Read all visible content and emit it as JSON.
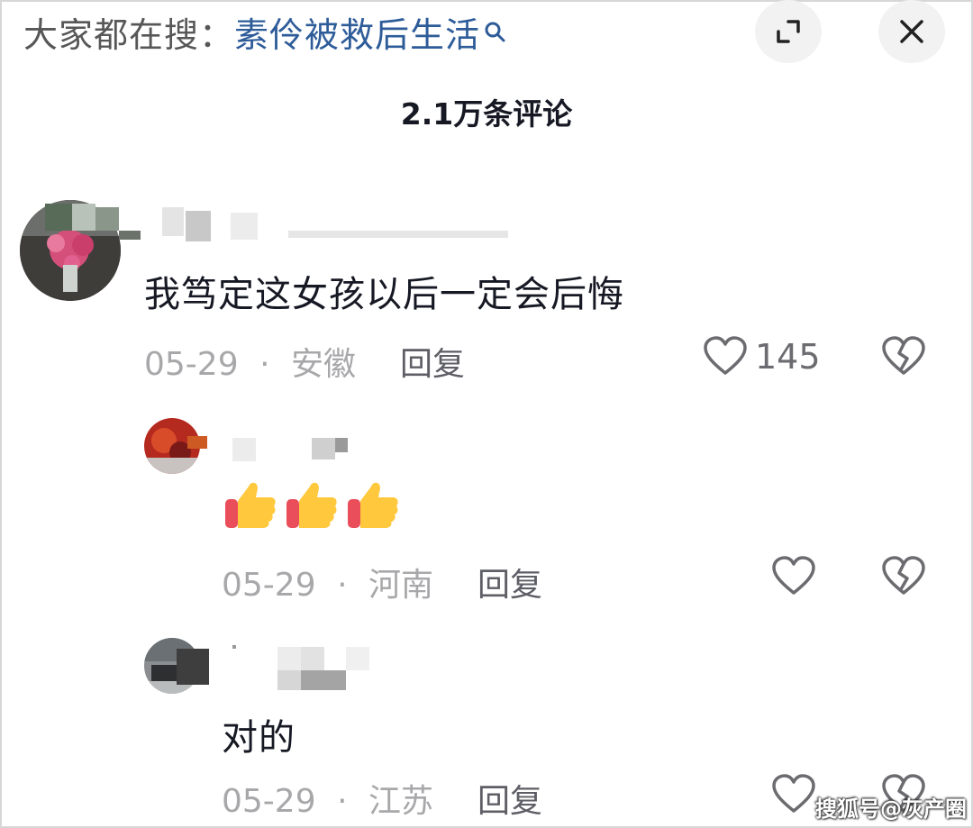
{
  "search": {
    "prefix": "大家都在搜：",
    "term": "素伶被救后生活",
    "icon": "search-icon"
  },
  "header": {
    "comment_count": "2.1万条评论",
    "expand_icon": "expand-icon",
    "close_icon": "close-icon"
  },
  "comments": [
    {
      "text": "我笃定这女孩以后一定会后悔",
      "date": "05-29",
      "sep": "·",
      "location": "安徽",
      "reply_label": "回复",
      "likes": "145"
    }
  ],
  "replies": [
    {
      "text": "👍👍👍",
      "date": "05-29",
      "sep": "·",
      "location": "河南",
      "reply_label": "回复"
    },
    {
      "text": "对的",
      "date": "05-29",
      "sep": "·",
      "location": "江苏",
      "reply_label": "回复"
    }
  ],
  "watermark": "搜狐号@灰产圈",
  "colors": {
    "search_term": "#2e5c99",
    "meta_gray": "#a8a8ab",
    "text_dark": "#161823"
  }
}
